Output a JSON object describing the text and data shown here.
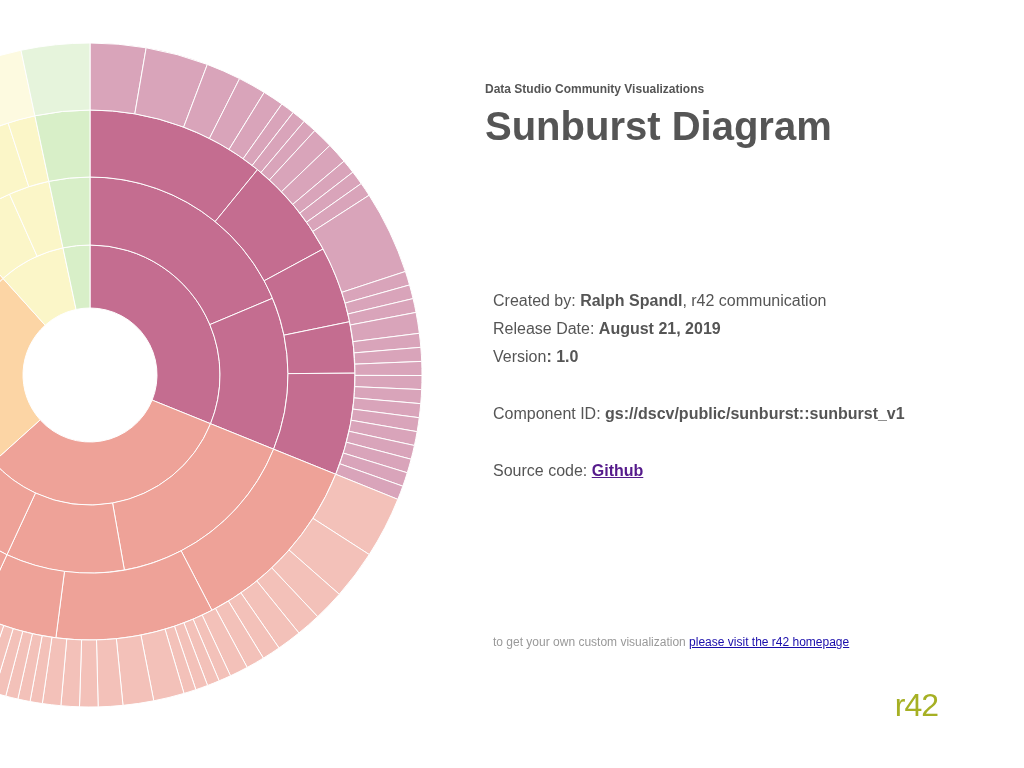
{
  "header": {
    "subtitle": "Data Studio Community Visualizations",
    "title": "Sunburst Diagram"
  },
  "details": [
    "Created by: **Ralph Spandl**, r42 communication",
    "Release Date: **August 21, 2019**",
    "Version**: 1.0**"
  ],
  "component_id": "Component ID: **gs://dscv/public/sunburst::sunburst_v1**",
  "source": {
    "label": "Source code:",
    "link": "Github"
  },
  "footer": {
    "text": "to get your own custom visualization",
    "link": "please visit the r42 homepage"
  },
  "logo": "r42"
}
